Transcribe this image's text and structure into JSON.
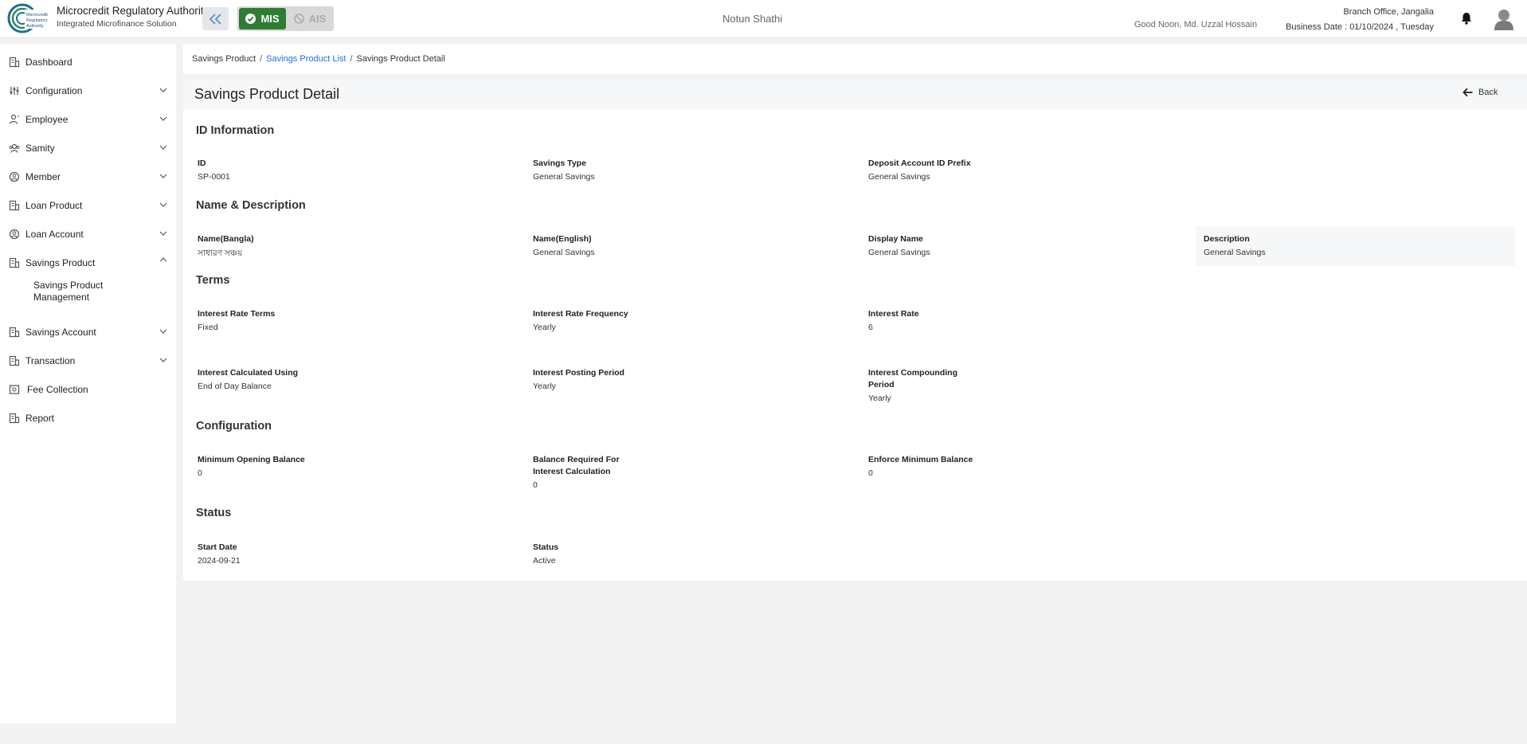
{
  "header": {
    "logo_text": "Microcredit Regulatory Authority",
    "org_name": "Microcredit Regulatory Authority",
    "org_subtitle": "Integrated Microfinance Solution",
    "modules": [
      {
        "label": "MIS",
        "active": true
      },
      {
        "label": "AIS",
        "active": false
      }
    ],
    "center_title": "Notun Shathi",
    "greeting": "Good Noon, Md. Uzzal Hossain",
    "branch": "Branch Office, Jangalia",
    "business_date": "Business Date : 01/10/2024 , Tuesday",
    "colors": {
      "mis": "#2e7d32",
      "link": "#1e6fd9"
    }
  },
  "sidebar": {
    "items": [
      {
        "label": "Dashboard",
        "icon": "building-icon",
        "expandable": false
      },
      {
        "label": "Configuration",
        "icon": "sliders-icon",
        "expandable": true
      },
      {
        "label": "Employee",
        "icon": "employee-icon",
        "expandable": true
      },
      {
        "label": "Samity",
        "icon": "group-icon",
        "expandable": true
      },
      {
        "label": "Member",
        "icon": "member-icon",
        "expandable": true
      },
      {
        "label": "Loan Product",
        "icon": "building-icon",
        "expandable": true
      },
      {
        "label": "Loan Account",
        "icon": "member-icon",
        "expandable": true
      },
      {
        "label": "Savings Product",
        "icon": "building-icon",
        "expandable": true,
        "expanded": true
      },
      {
        "label": "Savings Account",
        "icon": "building-icon",
        "expandable": true
      },
      {
        "label": "Transaction",
        "icon": "building-icon",
        "expandable": true
      },
      {
        "label": "Fee Collection",
        "icon": "cash-icon",
        "expandable": false
      },
      {
        "label": "Report",
        "icon": "building-icon",
        "expandable": false
      }
    ],
    "sub_item": "Savings Product Management"
  },
  "breadcrumb": {
    "root": "Savings Product",
    "list": "Savings Product List",
    "current": "Savings Product Detail"
  },
  "page": {
    "title": "Savings Product Detail",
    "back_label": "Back"
  },
  "sections": {
    "id_info": {
      "title": "ID Information",
      "fields": [
        {
          "label": "ID",
          "value": "SP-0001"
        },
        {
          "label": "Savings Type",
          "value": "General Savings"
        },
        {
          "label": "Deposit Account ID Prefix",
          "value": "General Savings"
        }
      ]
    },
    "name_desc": {
      "title": "Name & Description",
      "fields": [
        {
          "label": "Name(Bangla)",
          "value": "সাধারণ সঞ্চয়"
        },
        {
          "label": "Name(English)",
          "value": "General Savings"
        },
        {
          "label": "Display Name",
          "value": "General Savings"
        },
        {
          "label": "Description",
          "value": "General Savings"
        }
      ]
    },
    "terms": {
      "title": "Terms",
      "fields": [
        {
          "label": "Interest Rate Terms",
          "value": "Fixed"
        },
        {
          "label": "Interest Rate Frequency",
          "value": "Yearly"
        },
        {
          "label": "Interest Rate",
          "value": "6"
        },
        {
          "label": "Interest Calculated Using",
          "value": "End of Day Balance"
        },
        {
          "label": "Interest Posting Period",
          "value": "Yearly"
        },
        {
          "label": "Interest Compounding Period",
          "value": "Yearly"
        }
      ]
    },
    "configuration": {
      "title": "Configuration",
      "fields": [
        {
          "label": "Minimum Opening Balance",
          "value": "0"
        },
        {
          "label": "Balance Required For Interest Calculation",
          "value": "0"
        },
        {
          "label": "Enforce Minimum Balance",
          "value": "0"
        }
      ]
    },
    "status": {
      "title": "Status",
      "fields": [
        {
          "label": "Start Date",
          "value": "2024-09-21"
        },
        {
          "label": "Status",
          "value": "Active"
        }
      ]
    }
  }
}
